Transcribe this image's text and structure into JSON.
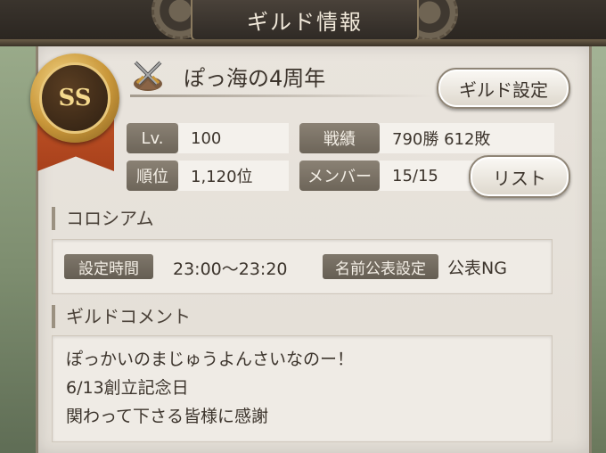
{
  "header": {
    "title": "ギルド情報"
  },
  "guild": {
    "rank_badge": "SS",
    "icon": "crossed-swords-icon",
    "name": "ぽっ海の4周年",
    "settings_label": "ギルド設定"
  },
  "stats": {
    "level_label": "Lv.",
    "level_value": "100",
    "record_label": "戦績",
    "record_value": "790勝  612敗",
    "rank_label": "順位",
    "rank_value": "1,120位",
    "members_label": "メンバー",
    "members_value": "15/15",
    "list_label": "リスト"
  },
  "colosseum": {
    "heading": "コロシアム",
    "time_label": "設定時間",
    "time_value": "23:00～23:20",
    "public_name_label": "名前公表設定",
    "public_name_value": "公表NG"
  },
  "comment": {
    "heading": "ギルドコメント",
    "lines": [
      "ぽっかいのまじゅうよんさいなのー！",
      "6/13創立記念日",
      "関わって下さる皆様に感謝"
    ]
  },
  "colors": {
    "panel": "#e9e4dd",
    "label_bg": "#7a7266",
    "ribbon": "#b84b22",
    "badge_gold": "#c9973a"
  }
}
